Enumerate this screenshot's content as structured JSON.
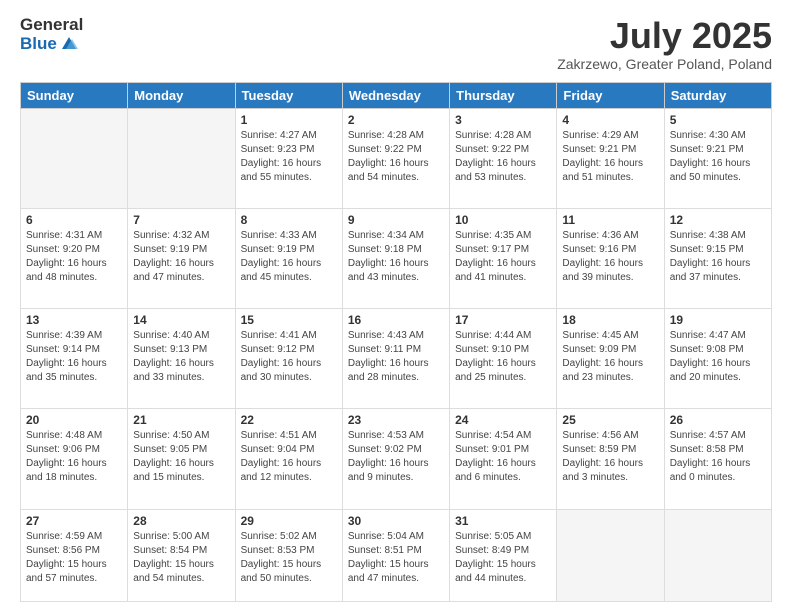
{
  "logo": {
    "general": "General",
    "blue": "Blue"
  },
  "title": "July 2025",
  "subtitle": "Zakrzewo, Greater Poland, Poland",
  "days_header": [
    "Sunday",
    "Monday",
    "Tuesday",
    "Wednesday",
    "Thursday",
    "Friday",
    "Saturday"
  ],
  "weeks": [
    [
      {
        "day": "",
        "info": ""
      },
      {
        "day": "",
        "info": ""
      },
      {
        "day": "1",
        "info": "Sunrise: 4:27 AM\nSunset: 9:23 PM\nDaylight: 16 hours and 55 minutes."
      },
      {
        "day": "2",
        "info": "Sunrise: 4:28 AM\nSunset: 9:22 PM\nDaylight: 16 hours and 54 minutes."
      },
      {
        "day": "3",
        "info": "Sunrise: 4:28 AM\nSunset: 9:22 PM\nDaylight: 16 hours and 53 minutes."
      },
      {
        "day": "4",
        "info": "Sunrise: 4:29 AM\nSunset: 9:21 PM\nDaylight: 16 hours and 51 minutes."
      },
      {
        "day": "5",
        "info": "Sunrise: 4:30 AM\nSunset: 9:21 PM\nDaylight: 16 hours and 50 minutes."
      }
    ],
    [
      {
        "day": "6",
        "info": "Sunrise: 4:31 AM\nSunset: 9:20 PM\nDaylight: 16 hours and 48 minutes."
      },
      {
        "day": "7",
        "info": "Sunrise: 4:32 AM\nSunset: 9:19 PM\nDaylight: 16 hours and 47 minutes."
      },
      {
        "day": "8",
        "info": "Sunrise: 4:33 AM\nSunset: 9:19 PM\nDaylight: 16 hours and 45 minutes."
      },
      {
        "day": "9",
        "info": "Sunrise: 4:34 AM\nSunset: 9:18 PM\nDaylight: 16 hours and 43 minutes."
      },
      {
        "day": "10",
        "info": "Sunrise: 4:35 AM\nSunset: 9:17 PM\nDaylight: 16 hours and 41 minutes."
      },
      {
        "day": "11",
        "info": "Sunrise: 4:36 AM\nSunset: 9:16 PM\nDaylight: 16 hours and 39 minutes."
      },
      {
        "day": "12",
        "info": "Sunrise: 4:38 AM\nSunset: 9:15 PM\nDaylight: 16 hours and 37 minutes."
      }
    ],
    [
      {
        "day": "13",
        "info": "Sunrise: 4:39 AM\nSunset: 9:14 PM\nDaylight: 16 hours and 35 minutes."
      },
      {
        "day": "14",
        "info": "Sunrise: 4:40 AM\nSunset: 9:13 PM\nDaylight: 16 hours and 33 minutes."
      },
      {
        "day": "15",
        "info": "Sunrise: 4:41 AM\nSunset: 9:12 PM\nDaylight: 16 hours and 30 minutes."
      },
      {
        "day": "16",
        "info": "Sunrise: 4:43 AM\nSunset: 9:11 PM\nDaylight: 16 hours and 28 minutes."
      },
      {
        "day": "17",
        "info": "Sunrise: 4:44 AM\nSunset: 9:10 PM\nDaylight: 16 hours and 25 minutes."
      },
      {
        "day": "18",
        "info": "Sunrise: 4:45 AM\nSunset: 9:09 PM\nDaylight: 16 hours and 23 minutes."
      },
      {
        "day": "19",
        "info": "Sunrise: 4:47 AM\nSunset: 9:08 PM\nDaylight: 16 hours and 20 minutes."
      }
    ],
    [
      {
        "day": "20",
        "info": "Sunrise: 4:48 AM\nSunset: 9:06 PM\nDaylight: 16 hours and 18 minutes."
      },
      {
        "day": "21",
        "info": "Sunrise: 4:50 AM\nSunset: 9:05 PM\nDaylight: 16 hours and 15 minutes."
      },
      {
        "day": "22",
        "info": "Sunrise: 4:51 AM\nSunset: 9:04 PM\nDaylight: 16 hours and 12 minutes."
      },
      {
        "day": "23",
        "info": "Sunrise: 4:53 AM\nSunset: 9:02 PM\nDaylight: 16 hours and 9 minutes."
      },
      {
        "day": "24",
        "info": "Sunrise: 4:54 AM\nSunset: 9:01 PM\nDaylight: 16 hours and 6 minutes."
      },
      {
        "day": "25",
        "info": "Sunrise: 4:56 AM\nSunset: 8:59 PM\nDaylight: 16 hours and 3 minutes."
      },
      {
        "day": "26",
        "info": "Sunrise: 4:57 AM\nSunset: 8:58 PM\nDaylight: 16 hours and 0 minutes."
      }
    ],
    [
      {
        "day": "27",
        "info": "Sunrise: 4:59 AM\nSunset: 8:56 PM\nDaylight: 15 hours and 57 minutes."
      },
      {
        "day": "28",
        "info": "Sunrise: 5:00 AM\nSunset: 8:54 PM\nDaylight: 15 hours and 54 minutes."
      },
      {
        "day": "29",
        "info": "Sunrise: 5:02 AM\nSunset: 8:53 PM\nDaylight: 15 hours and 50 minutes."
      },
      {
        "day": "30",
        "info": "Sunrise: 5:04 AM\nSunset: 8:51 PM\nDaylight: 15 hours and 47 minutes."
      },
      {
        "day": "31",
        "info": "Sunrise: 5:05 AM\nSunset: 8:49 PM\nDaylight: 15 hours and 44 minutes."
      },
      {
        "day": "",
        "info": ""
      },
      {
        "day": "",
        "info": ""
      }
    ]
  ]
}
